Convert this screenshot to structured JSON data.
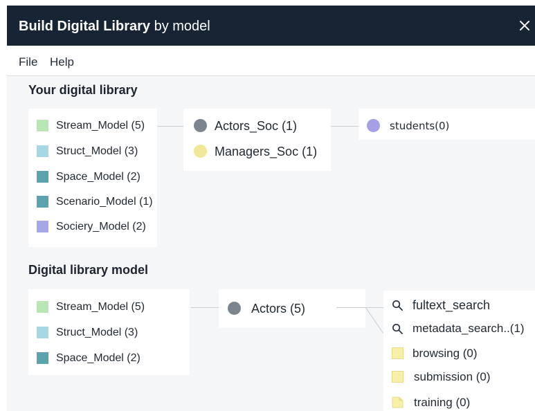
{
  "window": {
    "title_bold": "Build Digital Library",
    "title_rest": "by model",
    "close_icon": "close-icon"
  },
  "menu": {
    "file": "File",
    "help": "Help"
  },
  "colors": {
    "stream": "#b9e7b4",
    "struct": "#a6d8e4",
    "space": "#5aa5ad",
    "scenario": "#5aa5ad",
    "society": "#a5a7e8",
    "actors_dot": "#7c858e",
    "managers_dot": "#f0e896",
    "students_dot": "#a5a0e6",
    "folder": "#f8f0a8"
  },
  "your_library": {
    "heading": "Your digital library",
    "models": [
      {
        "label": "Stream_Model (5)"
      },
      {
        "label": "Struct_Model (3)"
      },
      {
        "label": "Space_Model (2)"
      },
      {
        "label": "Scenario_Model (1)"
      },
      {
        "label": "Sociery_Model (2)"
      }
    ],
    "societies": [
      {
        "label": "Actors_Soc (1)"
      },
      {
        "label": "Managers_Soc (1)"
      }
    ],
    "actors": [
      {
        "label": "students(0)"
      }
    ]
  },
  "library_model": {
    "heading": "Digital library model",
    "models": [
      {
        "label": "Stream_Model (5)"
      },
      {
        "label": "Struct_Model (3)"
      },
      {
        "label": "Space_Model (2)"
      }
    ],
    "actors": {
      "label": "Actors (5)"
    },
    "services": [
      {
        "label": "fultext_search",
        "icon": "search-icon"
      },
      {
        "label": "metadata_search..(1)",
        "icon": "search-icon"
      },
      {
        "label": "browsing (0)",
        "icon": "folder-icon"
      },
      {
        "label": "submission (0)",
        "icon": "folder-icon"
      },
      {
        "label": "training (0)",
        "icon": "document-icon"
      }
    ]
  }
}
